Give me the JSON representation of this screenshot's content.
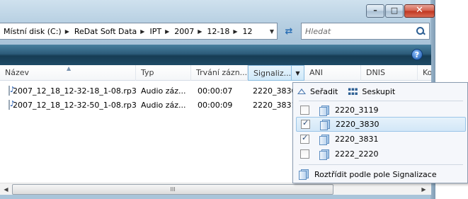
{
  "window": {
    "caption": {
      "minimize_glyph": "–",
      "maximize_glyph": "□",
      "close_glyph": "✕"
    }
  },
  "address_bar": {
    "crumbs": [
      {
        "label": "Místní disk (C:)"
      },
      {
        "label": "ReDat Soft Data"
      },
      {
        "label": "IPT"
      },
      {
        "label": "2007"
      },
      {
        "label": "12-18"
      },
      {
        "label": "12"
      }
    ],
    "arrow": "▶",
    "dropdown": "▼"
  },
  "refresh_glyph": "⇄",
  "search": {
    "placeholder": "Hledat"
  },
  "help_glyph": "?",
  "columns": [
    {
      "label": "Název"
    },
    {
      "label": "Typ"
    },
    {
      "label": "Trvání zázn..."
    },
    {
      "label": "Signaliz..."
    },
    {
      "label": "ANI"
    },
    {
      "label": "DNIS"
    },
    {
      "label": "Ko"
    }
  ],
  "sort_arrow": "▲",
  "files": [
    {
      "name": "2007_12_18_12-32-18_1-08.rp3",
      "type": "Audio záz...",
      "duration": "00:00:07",
      "signal": "2220_3830"
    },
    {
      "name": "2007_12_18_12-32-50_1-08.rp3",
      "type": "Audio záz...",
      "duration": "00:00:09",
      "signal": "2220_3831"
    }
  ],
  "scrollbar": {
    "left": "◀",
    "right": "▶",
    "grip": "III"
  },
  "filter_menu": {
    "sort_label": "Seřadit",
    "group_label": "Seskupit",
    "options": [
      {
        "label": "2220_3119",
        "checked": false,
        "highlighted": false
      },
      {
        "label": "2220_3830",
        "checked": true,
        "highlighted": true
      },
      {
        "label": "2220_3831",
        "checked": true,
        "highlighted": false
      },
      {
        "label": "2222_2220",
        "checked": false,
        "highlighted": false
      }
    ],
    "stack_label": "Roztřídit podle pole Signalizace"
  }
}
